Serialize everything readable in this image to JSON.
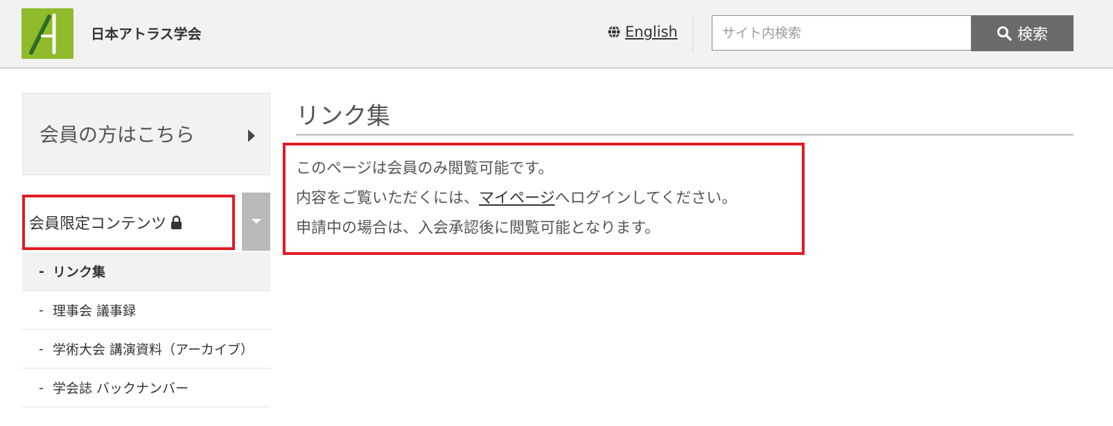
{
  "header": {
    "site_name": "日本アトラス学会",
    "language_link": "English",
    "search": {
      "placeholder": "サイト内検索",
      "button_label": "検索"
    }
  },
  "sidebar": {
    "member_link": "会員の方はこちら",
    "restricted_section": "会員限定コンテンツ",
    "items": [
      {
        "label": "リンク集",
        "active": true
      },
      {
        "label": "理事会 議事録",
        "active": false
      },
      {
        "label": "学術大会 講演資料（アーカイブ）",
        "active": false
      },
      {
        "label": "学会誌 バックナンバー",
        "active": false
      }
    ],
    "dash": "-"
  },
  "main": {
    "title": "リンク集",
    "notice": {
      "line1": "このページは会員のみ閲覧可能です。",
      "line2_before": "内容をご覧いただくには、",
      "line2_link": "マイページ",
      "line2_after": "へログインしてください。",
      "line3": "申請中の場合は、入会承認後に閲覧可能となります。"
    }
  },
  "colors": {
    "logo_green": "#8fba2a",
    "search_button": "#6b6b6b",
    "highlight_red": "#e01b24",
    "toggle_gray": "#b9b9b9"
  },
  "icons": [
    "logo-icon",
    "globe-icon",
    "search-icon",
    "caret-right-icon",
    "lock-icon",
    "caret-down-icon"
  ]
}
